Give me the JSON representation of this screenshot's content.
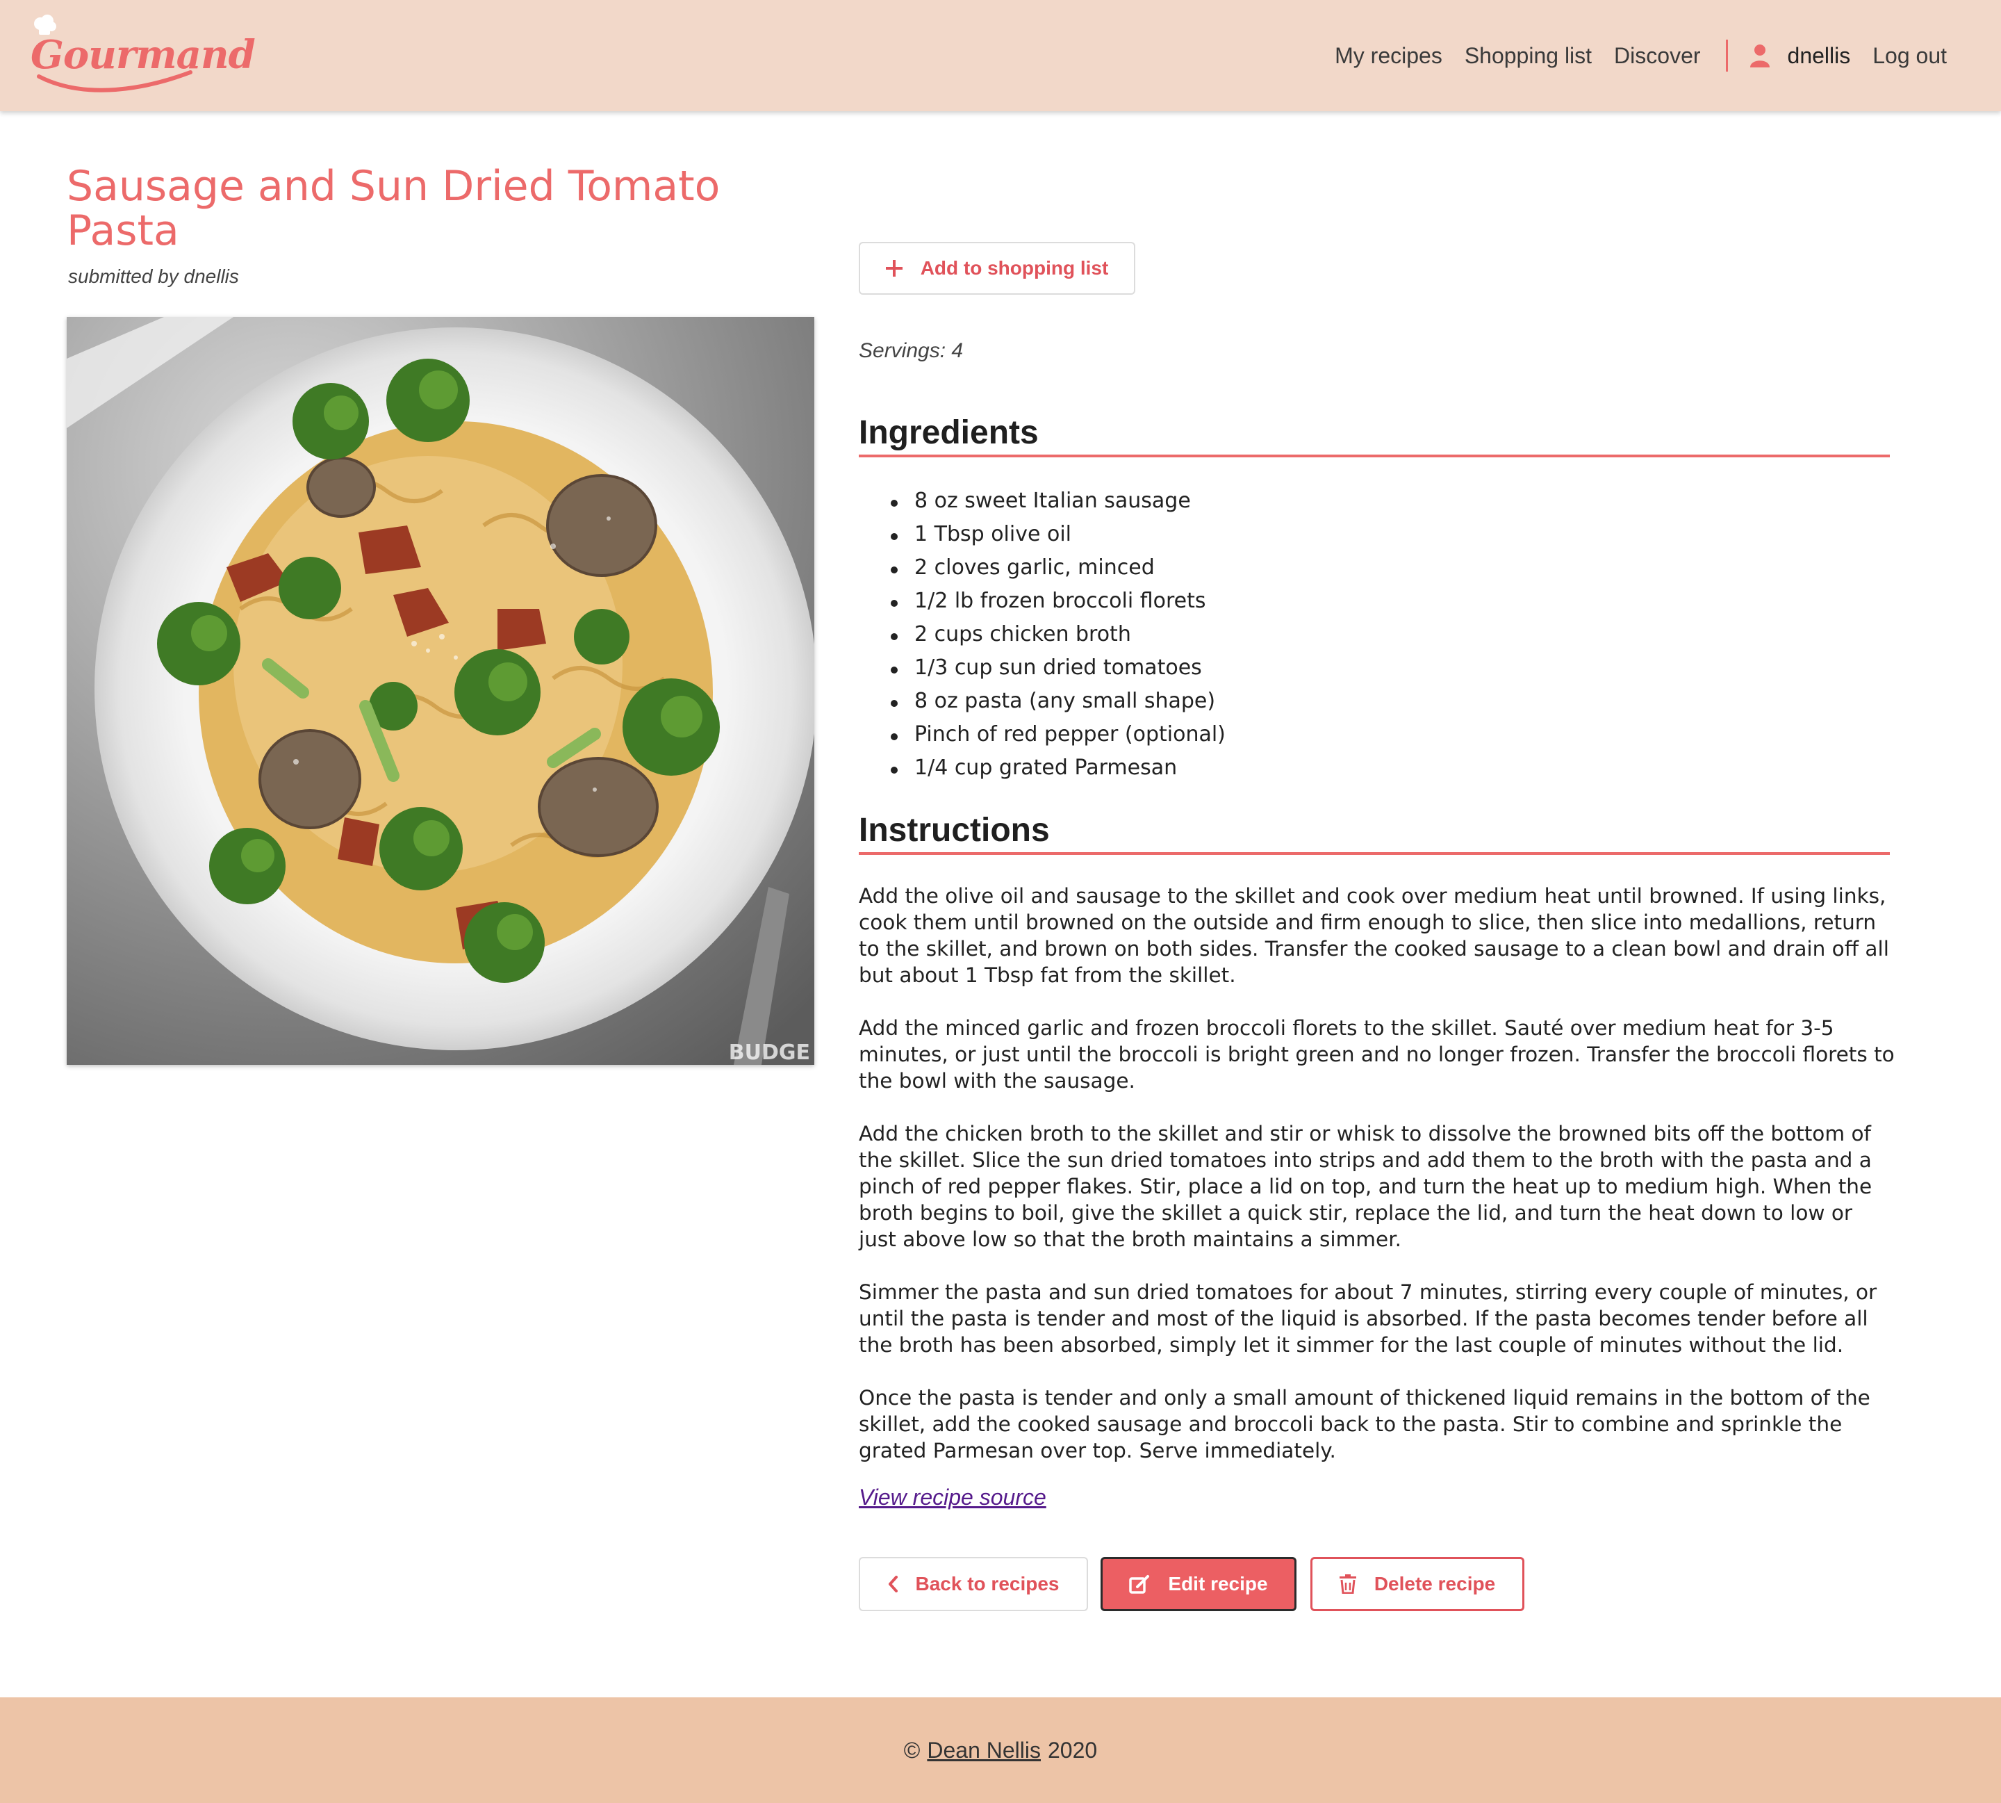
{
  "brand": {
    "name": "Gourmand"
  },
  "nav": {
    "links": [
      "My recipes",
      "Shopping list",
      "Discover"
    ],
    "username": "dnellis",
    "logout": "Log out"
  },
  "recipe": {
    "title": "Sausage and Sun Dried Tomato Pasta",
    "submitted_by": "submitted by dnellis",
    "image_watermark": "BUDGE",
    "servings": "Servings: 4",
    "ingredients_heading": "Ingredients",
    "ingredients": [
      "8 oz sweet Italian sausage",
      "1 Tbsp olive oil",
      "2 cloves garlic, minced",
      "1/2 lb frozen broccoli florets",
      "2 cups chicken broth",
      "1/3 cup sun dried tomatoes",
      "8 oz pasta (any small shape)",
      "Pinch of red pepper (optional)",
      "1/4 cup grated Parmesan"
    ],
    "instructions_heading": "Instructions",
    "instructions": [
      "Add the olive oil and sausage to the skillet and cook over medium heat until browned. If using links, cook them until browned on the outside and firm enough to slice, then slice into medallions, return to the skillet, and brown on both sides. Transfer the cooked sausage to a clean bowl and drain off all but about 1 Tbsp fat from the skillet.",
      "Add the minced garlic and frozen broccoli florets to the skillet. Sauté over medium heat for 3-5 minutes, or just until the broccoli is bright green and no longer frozen. Transfer the broccoli florets to the bowl with the sausage.",
      "Add the chicken broth to the skillet and stir or whisk to dissolve the browned bits off the bottom of the skillet. Slice the sun dried tomatoes into strips and add them to the broth with the pasta and a pinch of red pepper flakes. Stir, place a lid on top, and turn the heat up to medium high. When the broth begins to boil, give the skillet a quick stir, replace the lid, and turn the heat down to low or just above low so that the broth maintains a simmer.",
      "Simmer the pasta and sun dried tomatoes for about 7 minutes, stirring every couple of minutes, or until the pasta is tender and most of the liquid is absorbed. If the pasta becomes tender before all the broth has been absorbed, simply let it simmer for the last couple of minutes without the lid.",
      "Once the pasta is tender and only a small amount of thickened liquid remains in the bottom of the skillet, add the cooked sausage and broccoli back to the pasta. Stir to combine and sprinkle the grated Parmesan over top. Serve immediately."
    ],
    "source_link": "View recipe source"
  },
  "actions": {
    "add_to_shopping_list": "Add to shopping list",
    "back": "Back to recipes",
    "edit": "Edit recipe",
    "delete": "Delete recipe"
  },
  "footer": {
    "prefix": "©",
    "author": "Dean Nellis",
    "year": "2020"
  },
  "icons": {
    "plus": "plus-icon",
    "user": "user-icon",
    "chevron_left": "chevron-left-icon",
    "edit": "edit-icon",
    "trash": "trash-icon",
    "logo": "chef-hat-icon"
  },
  "colors": {
    "brand": "#ec6a6a",
    "navbar_bg": "#f2d8c9",
    "footer_bg": "#edc4a7",
    "button_red": "#ec5f63",
    "link_visited": "#551a8b"
  }
}
